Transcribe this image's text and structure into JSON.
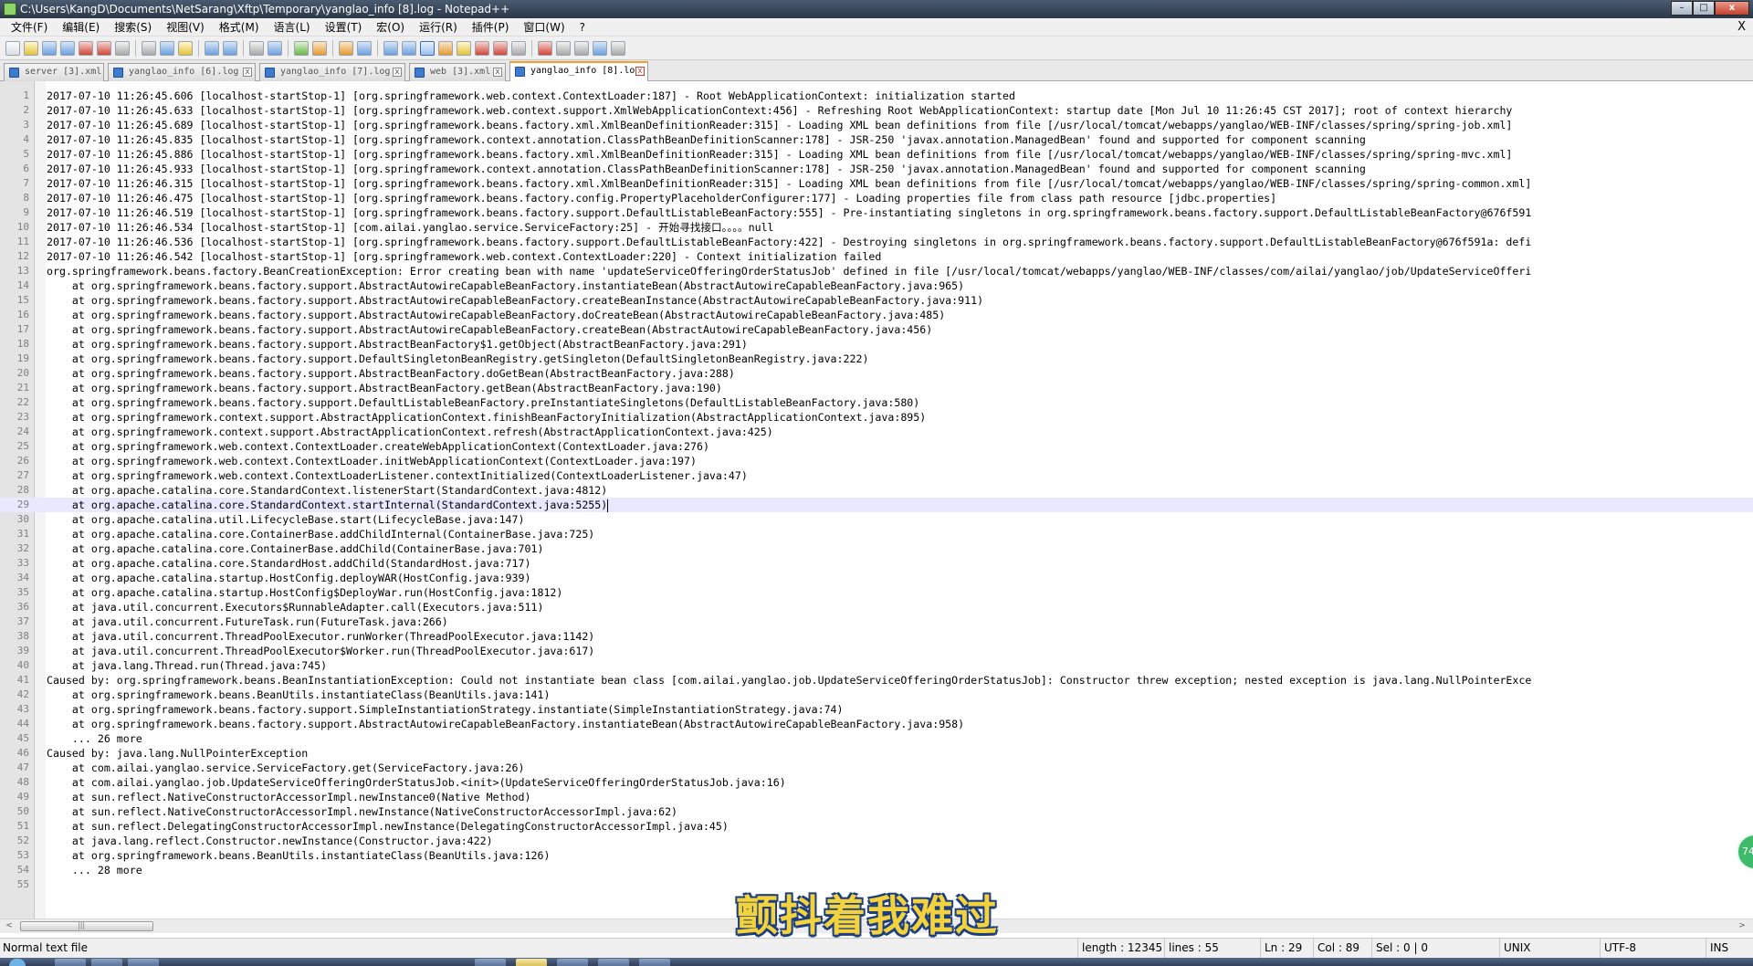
{
  "window": {
    "title": "C:\\Users\\KangD\\Documents\\NetSarang\\Xftp\\Temporary\\yanglao_info [8].log - Notepad++",
    "icon": "notepad-plus-plus-icon",
    "buttons": [
      "minimize",
      "maximize",
      "close"
    ],
    "minimize_glyph": "–",
    "maximize_glyph": "□",
    "close_glyph": "x",
    "doc_close_glyph": "X"
  },
  "menu": [
    "文件(F)",
    "编辑(E)",
    "搜索(S)",
    "视图(V)",
    "格式(M)",
    "语言(L)",
    "设置(T)",
    "宏(O)",
    "运行(R)",
    "插件(P)",
    "窗口(W)",
    "?"
  ],
  "toolbar_icons": [
    "new-file-icon",
    "open-file-icon",
    "save-icon",
    "save-all-icon",
    "close-icon",
    "close-all-icon",
    "print-icon",
    "cut-icon",
    "copy-icon",
    "paste-icon",
    "undo-icon",
    "redo-icon",
    "find-icon",
    "replace-icon",
    "zoom-in-icon",
    "zoom-out-icon",
    "sync-vertical-icon",
    "sync-horizontal-icon",
    "word-wrap-icon",
    "show-all-chars-icon",
    "indent-guide-icon",
    "user-language-icon",
    "doc-map-icon",
    "function-list-icon",
    "folder-workspace-icon",
    "monitoring-icon",
    "record-macro-icon",
    "stop-macro-icon",
    "playback-macro-icon",
    "run-macro-multiple-icon",
    "save-macro-icon"
  ],
  "tabs": [
    {
      "label": "server [3].xml",
      "active": false
    },
    {
      "label": "yanglao_info [6].log",
      "active": false
    },
    {
      "label": "yanglao_info [7].log",
      "active": false
    },
    {
      "label": "web [3].xml",
      "active": false
    },
    {
      "label": "yanglao_info [8].log",
      "active": true
    }
  ],
  "editor": {
    "current_line": 29,
    "lines": [
      "2017-07-10 11:26:45.606 [localhost-startStop-1] [org.springframework.web.context.ContextLoader:187] - Root WebApplicationContext: initialization started",
      "2017-07-10 11:26:45.633 [localhost-startStop-1] [org.springframework.web.context.support.XmlWebApplicationContext:456] - Refreshing Root WebApplicationContext: startup date [Mon Jul 10 11:26:45 CST 2017]; root of context hierarchy",
      "2017-07-10 11:26:45.689 [localhost-startStop-1] [org.springframework.beans.factory.xml.XmlBeanDefinitionReader:315] - Loading XML bean definitions from file [/usr/local/tomcat/webapps/yanglao/WEB-INF/classes/spring/spring-job.xml]",
      "2017-07-10 11:26:45.835 [localhost-startStop-1] [org.springframework.context.annotation.ClassPathBeanDefinitionScanner:178] - JSR-250 'javax.annotation.ManagedBean' found and supported for component scanning",
      "2017-07-10 11:26:45.886 [localhost-startStop-1] [org.springframework.beans.factory.xml.XmlBeanDefinitionReader:315] - Loading XML bean definitions from file [/usr/local/tomcat/webapps/yanglao/WEB-INF/classes/spring/spring-mvc.xml]",
      "2017-07-10 11:26:45.933 [localhost-startStop-1] [org.springframework.context.annotation.ClassPathBeanDefinitionScanner:178] - JSR-250 'javax.annotation.ManagedBean' found and supported for component scanning",
      "2017-07-10 11:26:46.315 [localhost-startStop-1] [org.springframework.beans.factory.xml.XmlBeanDefinitionReader:315] - Loading XML bean definitions from file [/usr/local/tomcat/webapps/yanglao/WEB-INF/classes/spring/spring-common.xml]",
      "2017-07-10 11:26:46.475 [localhost-startStop-1] [org.springframework.beans.factory.config.PropertyPlaceholderConfigurer:177] - Loading properties file from class path resource [jdbc.properties]",
      "2017-07-10 11:26:46.519 [localhost-startStop-1] [org.springframework.beans.factory.support.DefaultListableBeanFactory:555] - Pre-instantiating singletons in org.springframework.beans.factory.support.DefaultListableBeanFactory@676f591",
      "2017-07-10 11:26:46.534 [localhost-startStop-1] [com.ailai.yanglao.service.ServiceFactory:25] - 开始寻找接口。。。。null",
      "2017-07-10 11:26:46.536 [localhost-startStop-1] [org.springframework.beans.factory.support.DefaultListableBeanFactory:422] - Destroying singletons in org.springframework.beans.factory.support.DefaultListableBeanFactory@676f591a: defi",
      "2017-07-10 11:26:46.542 [localhost-startStop-1] [org.springframework.web.context.ContextLoader:220] - Context initialization failed",
      "org.springframework.beans.factory.BeanCreationException: Error creating bean with name 'updateServiceOfferingOrderStatusJob' defined in file [/usr/local/tomcat/webapps/yanglao/WEB-INF/classes/com/ailai/yanglao/job/UpdateServiceOfferi",
      "    at org.springframework.beans.factory.support.AbstractAutowireCapableBeanFactory.instantiateBean(AbstractAutowireCapableBeanFactory.java:965)",
      "    at org.springframework.beans.factory.support.AbstractAutowireCapableBeanFactory.createBeanInstance(AbstractAutowireCapableBeanFactory.java:911)",
      "    at org.springframework.beans.factory.support.AbstractAutowireCapableBeanFactory.doCreateBean(AbstractAutowireCapableBeanFactory.java:485)",
      "    at org.springframework.beans.factory.support.AbstractAutowireCapableBeanFactory.createBean(AbstractAutowireCapableBeanFactory.java:456)",
      "    at org.springframework.beans.factory.support.AbstractBeanFactory$1.getObject(AbstractBeanFactory.java:291)",
      "    at org.springframework.beans.factory.support.DefaultSingletonBeanRegistry.getSingleton(DefaultSingletonBeanRegistry.java:222)",
      "    at org.springframework.beans.factory.support.AbstractBeanFactory.doGetBean(AbstractBeanFactory.java:288)",
      "    at org.springframework.beans.factory.support.AbstractBeanFactory.getBean(AbstractBeanFactory.java:190)",
      "    at org.springframework.beans.factory.support.DefaultListableBeanFactory.preInstantiateSingletons(DefaultListableBeanFactory.java:580)",
      "    at org.springframework.context.support.AbstractApplicationContext.finishBeanFactoryInitialization(AbstractApplicationContext.java:895)",
      "    at org.springframework.context.support.AbstractApplicationContext.refresh(AbstractApplicationContext.java:425)",
      "    at org.springframework.web.context.ContextLoader.createWebApplicationContext(ContextLoader.java:276)",
      "    at org.springframework.web.context.ContextLoader.initWebApplicationContext(ContextLoader.java:197)",
      "    at org.springframework.web.context.ContextLoaderListener.contextInitialized(ContextLoaderListener.java:47)",
      "    at org.apache.catalina.core.StandardContext.listenerStart(StandardContext.java:4812)",
      "    at org.apache.catalina.core.StandardContext.startInternal(StandardContext.java:5255)",
      "    at org.apache.catalina.util.LifecycleBase.start(LifecycleBase.java:147)",
      "    at org.apache.catalina.core.ContainerBase.addChildInternal(ContainerBase.java:725)",
      "    at org.apache.catalina.core.ContainerBase.addChild(ContainerBase.java:701)",
      "    at org.apache.catalina.core.StandardHost.addChild(StandardHost.java:717)",
      "    at org.apache.catalina.startup.HostConfig.deployWAR(HostConfig.java:939)",
      "    at org.apache.catalina.startup.HostConfig$DeployWar.run(HostConfig.java:1812)",
      "    at java.util.concurrent.Executors$RunnableAdapter.call(Executors.java:511)",
      "    at java.util.concurrent.FutureTask.run(FutureTask.java:266)",
      "    at java.util.concurrent.ThreadPoolExecutor.runWorker(ThreadPoolExecutor.java:1142)",
      "    at java.util.concurrent.ThreadPoolExecutor$Worker.run(ThreadPoolExecutor.java:617)",
      "    at java.lang.Thread.run(Thread.java:745)",
      "Caused by: org.springframework.beans.BeanInstantiationException: Could not instantiate bean class [com.ailai.yanglao.job.UpdateServiceOfferingOrderStatusJob]: Constructor threw exception; nested exception is java.lang.NullPointerExce",
      "    at org.springframework.beans.BeanUtils.instantiateClass(BeanUtils.java:141)",
      "    at org.springframework.beans.factory.support.SimpleInstantiationStrategy.instantiate(SimpleInstantiationStrategy.java:74)",
      "    at org.springframework.beans.factory.support.AbstractAutowireCapableBeanFactory.instantiateBean(AbstractAutowireCapableBeanFactory.java:958)",
      "    ... 26 more",
      "Caused by: java.lang.NullPointerException",
      "    at com.ailai.yanglao.service.ServiceFactory.get(ServiceFactory.java:26)",
      "    at com.ailai.yanglao.job.UpdateServiceOfferingOrderStatusJob.<init>(UpdateServiceOfferingOrderStatusJob.java:16)",
      "    at sun.reflect.NativeConstructorAccessorImpl.newInstance0(Native Method)",
      "    at sun.reflect.NativeConstructorAccessorImpl.newInstance(NativeConstructorAccessorImpl.java:62)",
      "    at sun.reflect.DelegatingConstructorAccessorImpl.newInstance(DelegatingConstructorAccessorImpl.java:45)",
      "    at java.lang.reflect.Constructor.newInstance(Constructor.java:422)",
      "    at org.springframework.beans.BeanUtils.instantiateClass(BeanUtils.java:126)",
      "    ... 28 more",
      ""
    ]
  },
  "scrollbar": {
    "left_arrow": "<",
    "right_arrow": ">",
    "thumb_grip": "|||"
  },
  "overlay": {
    "subtitle": "颤抖着我难过",
    "badge_text": "74"
  },
  "status": {
    "file_type": "Normal text file",
    "length": "length : 12345",
    "lines": "lines : 55",
    "ln": "Ln : 29",
    "col": "Col : 89",
    "sel": "Sel : 0 | 0",
    "eol": "UNIX",
    "encoding": "UTF-8",
    "mode": "INS"
  },
  "colors": {
    "current_line_bg": "#e8e8ff",
    "line_number_fg": "#808080",
    "gutter_bg": "#e4e4e4",
    "active_tab_accent": "#f0a030",
    "subtitle_fill": "#f3d23c",
    "subtitle_outline": "#1d3f80"
  }
}
